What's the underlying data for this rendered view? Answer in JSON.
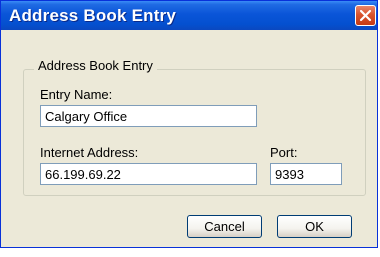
{
  "window": {
    "title": "Address Book Entry",
    "close_icon": "close-icon"
  },
  "group": {
    "label": "Address Book Entry"
  },
  "entry_name": {
    "label": "Entry Name:",
    "value": "Calgary Office"
  },
  "internet_address": {
    "label": "Internet Address:",
    "value": "66.199.69.22"
  },
  "port": {
    "label": "Port:",
    "value": "9393"
  },
  "buttons": {
    "cancel_label": "Cancel",
    "ok_label": "OK"
  },
  "colors": {
    "titlebar": "#0a55d8",
    "dialog_background": "#ece9d8",
    "close_button": "#d9542e",
    "input_border": "#7f9db9"
  }
}
